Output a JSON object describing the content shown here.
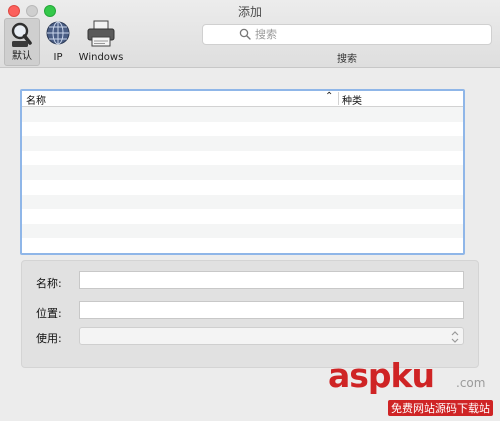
{
  "window": {
    "title": "添加"
  },
  "toolbar": {
    "items": [
      {
        "label": "默认",
        "icon": "magnifier-icon",
        "selected": true
      },
      {
        "label": "IP",
        "icon": "globe-icon",
        "selected": false
      },
      {
        "label": "Windows",
        "icon": "printer-icon",
        "selected": false
      }
    ],
    "search": {
      "placeholder": "搜索",
      "caption": "搜索"
    }
  },
  "table": {
    "columns": [
      "名称",
      "种类"
    ],
    "sort_indicator": "^",
    "rows": []
  },
  "form": {
    "name_label": "名称:",
    "location_label": "位置:",
    "use_label": "使用:",
    "name_value": "",
    "location_value": "",
    "use_value": ""
  },
  "watermark": {
    "brand_a": "asp",
    "brand_b": "ku",
    "tld": ".com",
    "subtitle": "免费网站源码下载站"
  },
  "colors": {
    "close": "#fc605c",
    "minimize": "#cfcfcf",
    "zoom": "#34c84a",
    "table_focus": "#8fb6e8",
    "watermark": "#cf2425"
  }
}
